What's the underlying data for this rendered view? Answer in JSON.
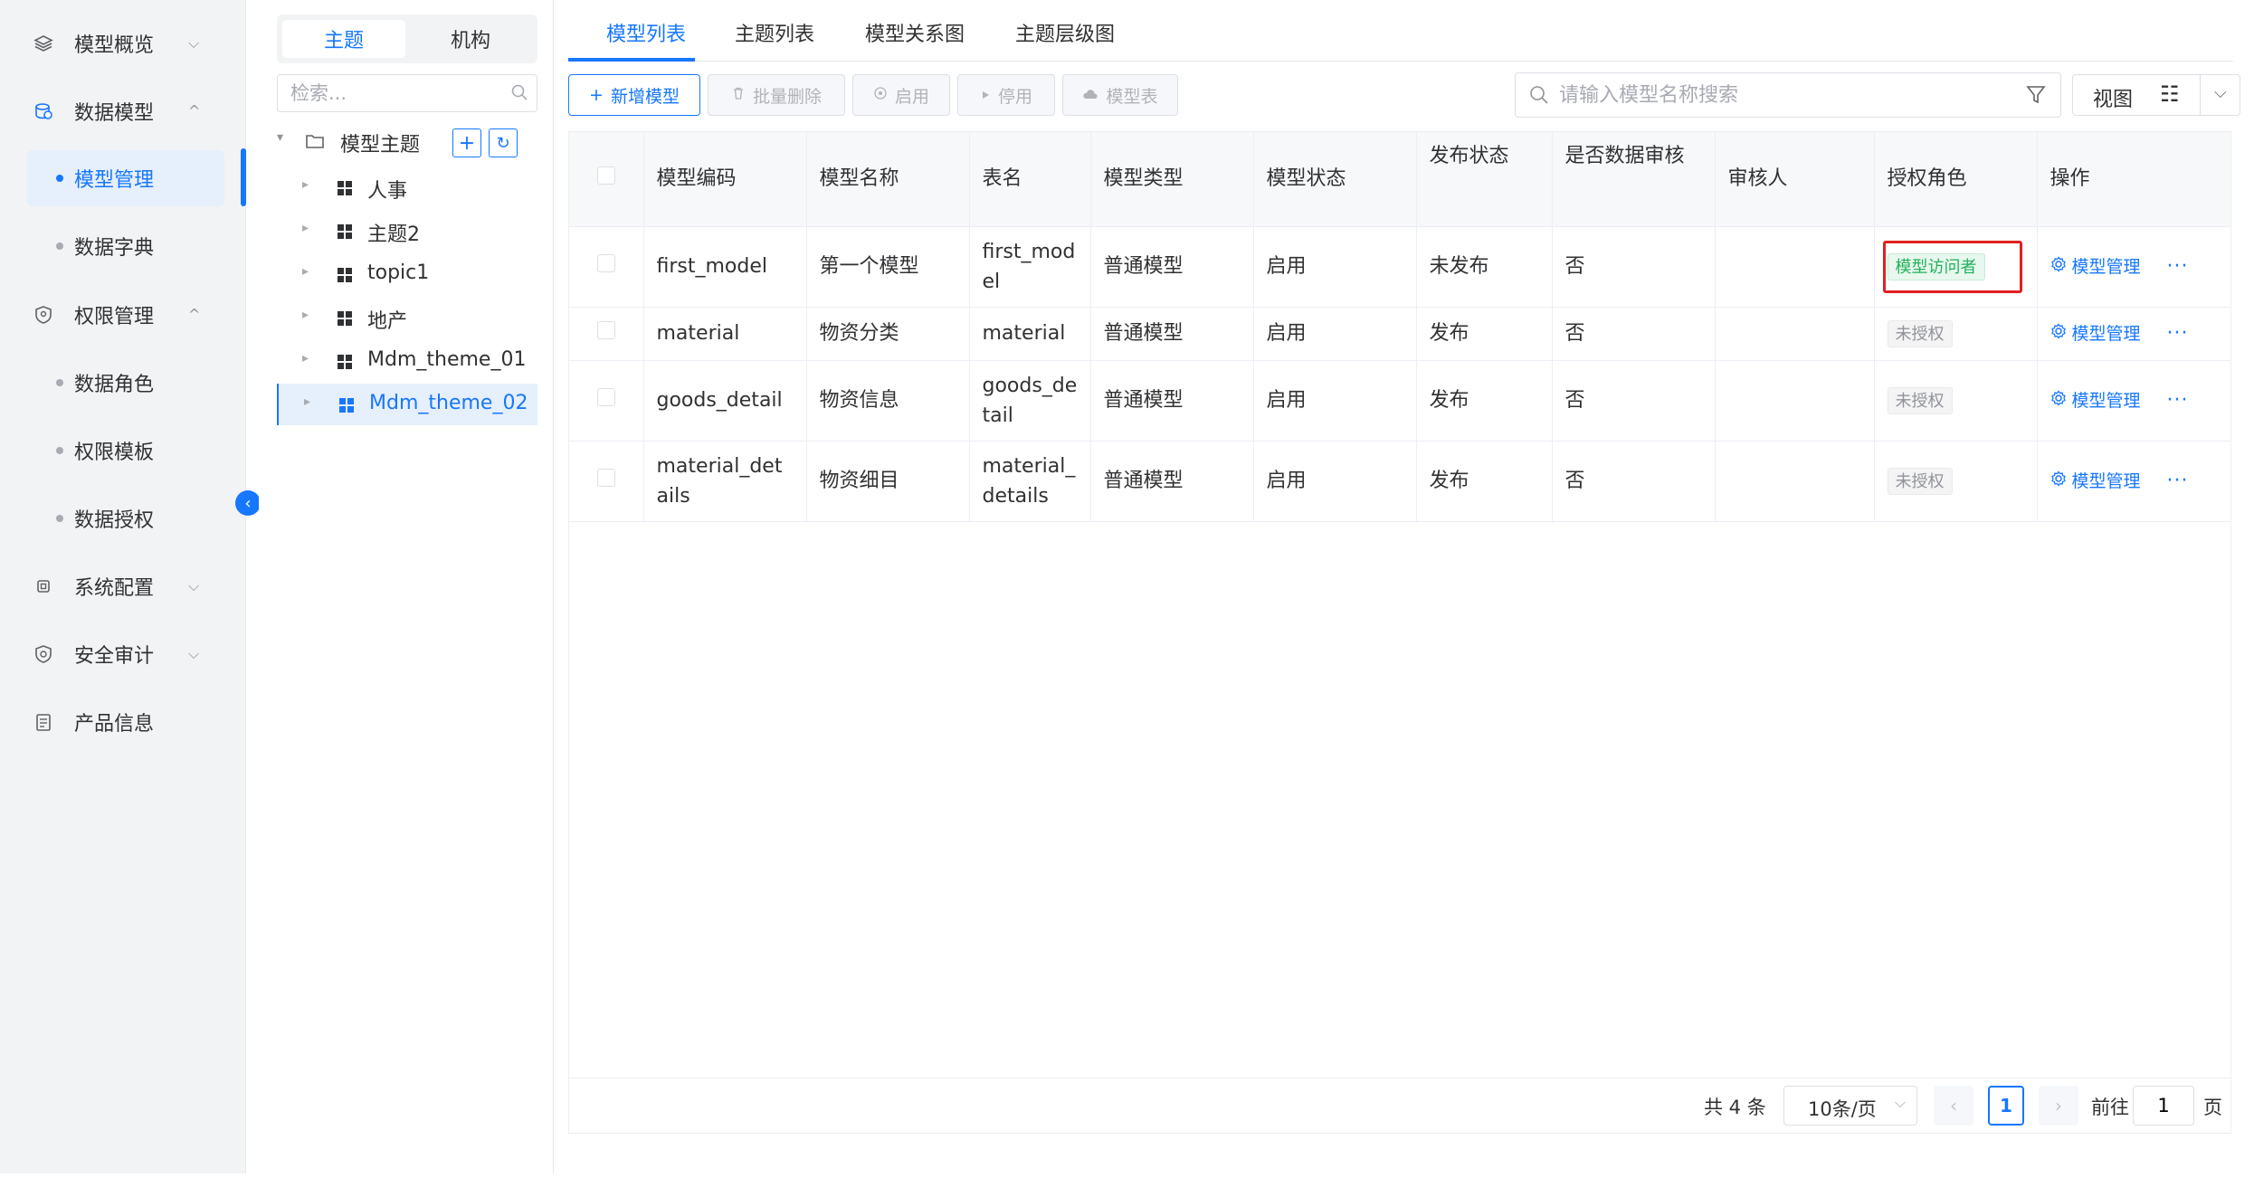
{
  "sidebar": {
    "items": [
      {
        "label": "模型概览",
        "icon": "layers-icon"
      },
      {
        "label": "数据模型",
        "icon": "database-icon"
      },
      {
        "label": "模型管理"
      },
      {
        "label": "数据字典"
      },
      {
        "label": "权限管理",
        "icon": "shield-icon"
      },
      {
        "label": "数据角色"
      },
      {
        "label": "权限模板"
      },
      {
        "label": "数据授权"
      },
      {
        "label": "系统配置",
        "icon": "chip-icon"
      },
      {
        "label": "安全审计",
        "icon": "shield-check-icon"
      },
      {
        "label": "产品信息",
        "icon": "document-icon"
      }
    ],
    "chevron_down": "⌵",
    "chevron_up": "^",
    "collapse_glyph": "‹"
  },
  "tree": {
    "seg": [
      "主题",
      "机构"
    ],
    "search_placeholder": "检索...",
    "root_label": "模型主题",
    "add_glyph": "+",
    "refresh_glyph": "↻",
    "nodes": [
      "人事",
      "主题2",
      "topic1",
      "地产",
      "Mdm_theme_01",
      "Mdm_theme_02"
    ],
    "node_arrow": "▸",
    "root_arrow": "▾"
  },
  "tabs": [
    "模型列表",
    "主题列表",
    "模型关系图",
    "主题层级图"
  ],
  "toolbar": {
    "add": "新增模型",
    "add_glyph": "+",
    "batch_delete": "批量删除",
    "enable": "启用",
    "disable": "停用",
    "model_table": "模型表",
    "search_placeholder": "请输入模型名称搜索",
    "view": "视图",
    "view_glyph": "☷",
    "dropdown_glyph": "⌵"
  },
  "table": {
    "headers": [
      "模型编码",
      "模型名称",
      "表名",
      "模型类型",
      "模型状态",
      "发布状态",
      "是否数据审核",
      "审核人",
      "授权角色",
      "操作"
    ],
    "rows": [
      {
        "code": "first_model",
        "name": "第一个模型",
        "table": "first_model",
        "type": "普通模型",
        "status": "启用",
        "publish": "未发布",
        "audit": "否",
        "auditor": "",
        "role": "模型访问者",
        "action": "模型管理"
      },
      {
        "code": "material",
        "name": "物资分类",
        "table": "material",
        "type": "普通模型",
        "status": "启用",
        "publish": "发布",
        "audit": "否",
        "auditor": "",
        "role": "未授权",
        "action": "模型管理"
      },
      {
        "code": "goods_detail",
        "name": "物资信息",
        "table": "goods_detail",
        "type": "普通模型",
        "status": "启用",
        "publish": "发布",
        "audit": "否",
        "auditor": "",
        "role": "未授权",
        "action": "模型管理"
      },
      {
        "code": "material_details",
        "name": "物资细目",
        "table": "material_details",
        "type": "普通模型",
        "status": "启用",
        "publish": "发布",
        "audit": "否",
        "auditor": "",
        "role": "未授权",
        "action": "模型管理"
      }
    ],
    "more_glyph": "···"
  },
  "pagination": {
    "total": "共 4 条",
    "page_size": "10条/页",
    "size_caret": "⌵",
    "prev": "‹",
    "current": "1",
    "next": "›",
    "goto_prefix": "前往",
    "goto_value": "1",
    "goto_suffix": "页"
  },
  "colors": {
    "accent": "#1677ff",
    "highlight": "#e02020",
    "tag_success": "#20b15a"
  }
}
